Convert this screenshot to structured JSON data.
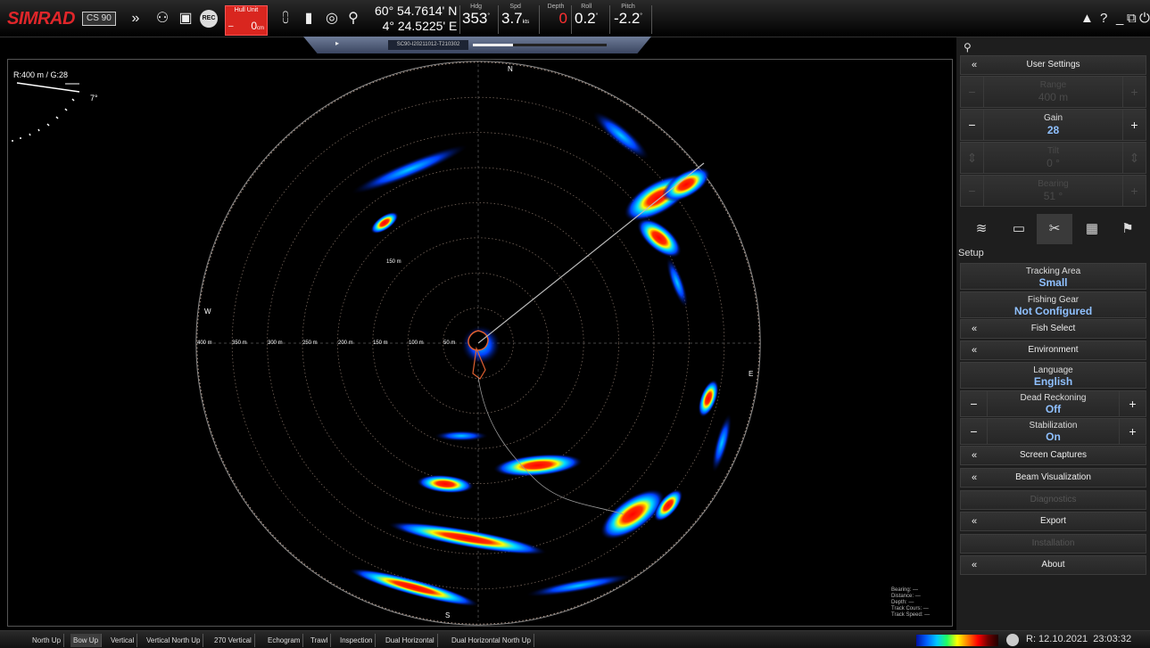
{
  "brand": {
    "name": "SIMRAD",
    "model": "CS 90"
  },
  "hull_unit": {
    "title": "Hull Unit",
    "minus": "–",
    "value": "0",
    "unit": "cm"
  },
  "position": {
    "lat": "60° 54.7614' N",
    "lon": "4° 24.5225' E"
  },
  "readouts": [
    {
      "label": "Hdg",
      "value": "353",
      "unit": "°"
    },
    {
      "label": "Spd",
      "value": "3.7",
      "unit": "kts"
    },
    {
      "label": "Depth",
      "value": "0",
      "unit": ""
    },
    {
      "label": "Roll",
      "value": "0.2",
      "unit": "°"
    },
    {
      "label": "Pitch",
      "value": "-2.2",
      "unit": "°"
    }
  ],
  "colors": {
    "brand_red": "#e0262a",
    "depth_red": "#ff3030",
    "value_blue": "#8fc0ff",
    "ring": "#d9b9a6"
  },
  "playback": {
    "file": "SC90-I20211012-T210302",
    "progress": 0.3
  },
  "sonar": {
    "range_gain": "R:400 m / G:28",
    "tilt": "7°",
    "cardinals": {
      "n": "N",
      "s": "S",
      "e": "E",
      "w": "W"
    },
    "ring_labels": [
      "400 m",
      "350 m",
      "300 m",
      "250 m",
      "200 m",
      "150 m",
      "100 m",
      "50 m"
    ],
    "ring_150_label": "150 m",
    "info": [
      {
        "label": "Bearing:",
        "value": "—"
      },
      {
        "label": "Distance:",
        "value": "—"
      },
      {
        "label": "Depth:",
        "value": "—"
      },
      {
        "label": "Track Cours:",
        "value": "—"
      },
      {
        "label": "Track Speed:",
        "value": "—"
      }
    ]
  },
  "panel": {
    "header": "User Settings",
    "range": {
      "label": "Range",
      "value": "400 m"
    },
    "gain": {
      "label": "Gain",
      "value": "28"
    },
    "tilt": {
      "label": "Tilt",
      "value": "0 °"
    },
    "bearing": {
      "label": "Bearing",
      "value": "51 °"
    },
    "tabs": [
      "beam-icon",
      "display-icon",
      "setup-icon",
      "layout-icon",
      "flag-icon"
    ],
    "setup_label": "Setup",
    "tracking_area": {
      "label": "Tracking Area",
      "value": "Small"
    },
    "fishing_gear": {
      "label": "Fishing Gear",
      "value": "Not Configured"
    },
    "fish_select": "Fish Select",
    "environment": "Environment",
    "language": {
      "label": "Language",
      "value": "English"
    },
    "dead_reckoning": {
      "label": "Dead Reckoning",
      "value": "Off"
    },
    "stabilization": {
      "label": "Stabilization",
      "value": "On"
    },
    "screen_captures": "Screen Captures",
    "beam_visualization": "Beam Visualization",
    "diagnostics": "Diagnostics",
    "export": "Export",
    "installation": "Installation",
    "about": "About"
  },
  "bottom": {
    "views": [
      "North Up",
      "Bow Up",
      "Vertical",
      "Vertical North Up",
      "270 Vertical",
      "Echogram",
      "Trawl",
      "Inspection",
      "Dual Horizontal",
      "Dual Horizontal North Up"
    ],
    "active_view": "Bow Up",
    "replay_date": "R: 12.10.2021",
    "time": "23:03:32"
  }
}
